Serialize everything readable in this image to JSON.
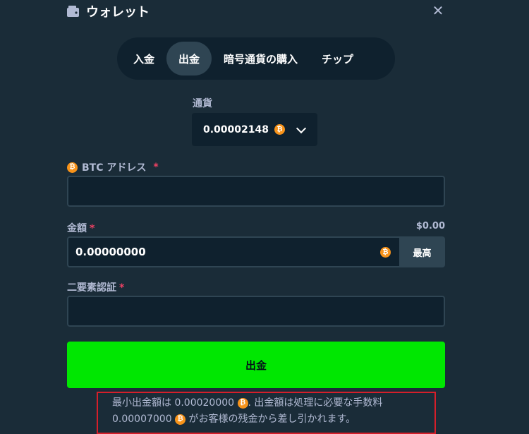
{
  "header": {
    "title": "ウォレット",
    "wallet_icon": "wallet-icon",
    "close_icon": "close-icon"
  },
  "tabs": [
    {
      "label": "入金",
      "active": false
    },
    {
      "label": "出金",
      "active": true
    },
    {
      "label": "暗号通貨の購入",
      "active": false
    },
    {
      "label": "チップ",
      "active": false
    }
  ],
  "currency": {
    "label": "通貨",
    "selected": "0.00002148",
    "icon": "btc-icon"
  },
  "address": {
    "label": "BTC アドレス",
    "required_mark": "*",
    "value": ""
  },
  "amount": {
    "label": "金額",
    "required_mark": "*",
    "usd_value": "$0.00",
    "value": "0.00000000",
    "max_label": "最高"
  },
  "two_factor": {
    "label": "二要素認証",
    "required_mark": "*",
    "value": ""
  },
  "withdraw_button": {
    "label": "出金"
  },
  "note": {
    "part1": "最小出金額は 0.00020000",
    "part2": ". 出金額は処理に必要な手数料",
    "part3": "0.00007000",
    "part4": "がお客様の残金から差し引かれます。"
  },
  "colors": {
    "background": "#1a2c38",
    "input_bg": "#0f212e",
    "accent_green": "#00e701",
    "btc_orange": "#f7931a",
    "highlight_red": "#d51f2a"
  }
}
